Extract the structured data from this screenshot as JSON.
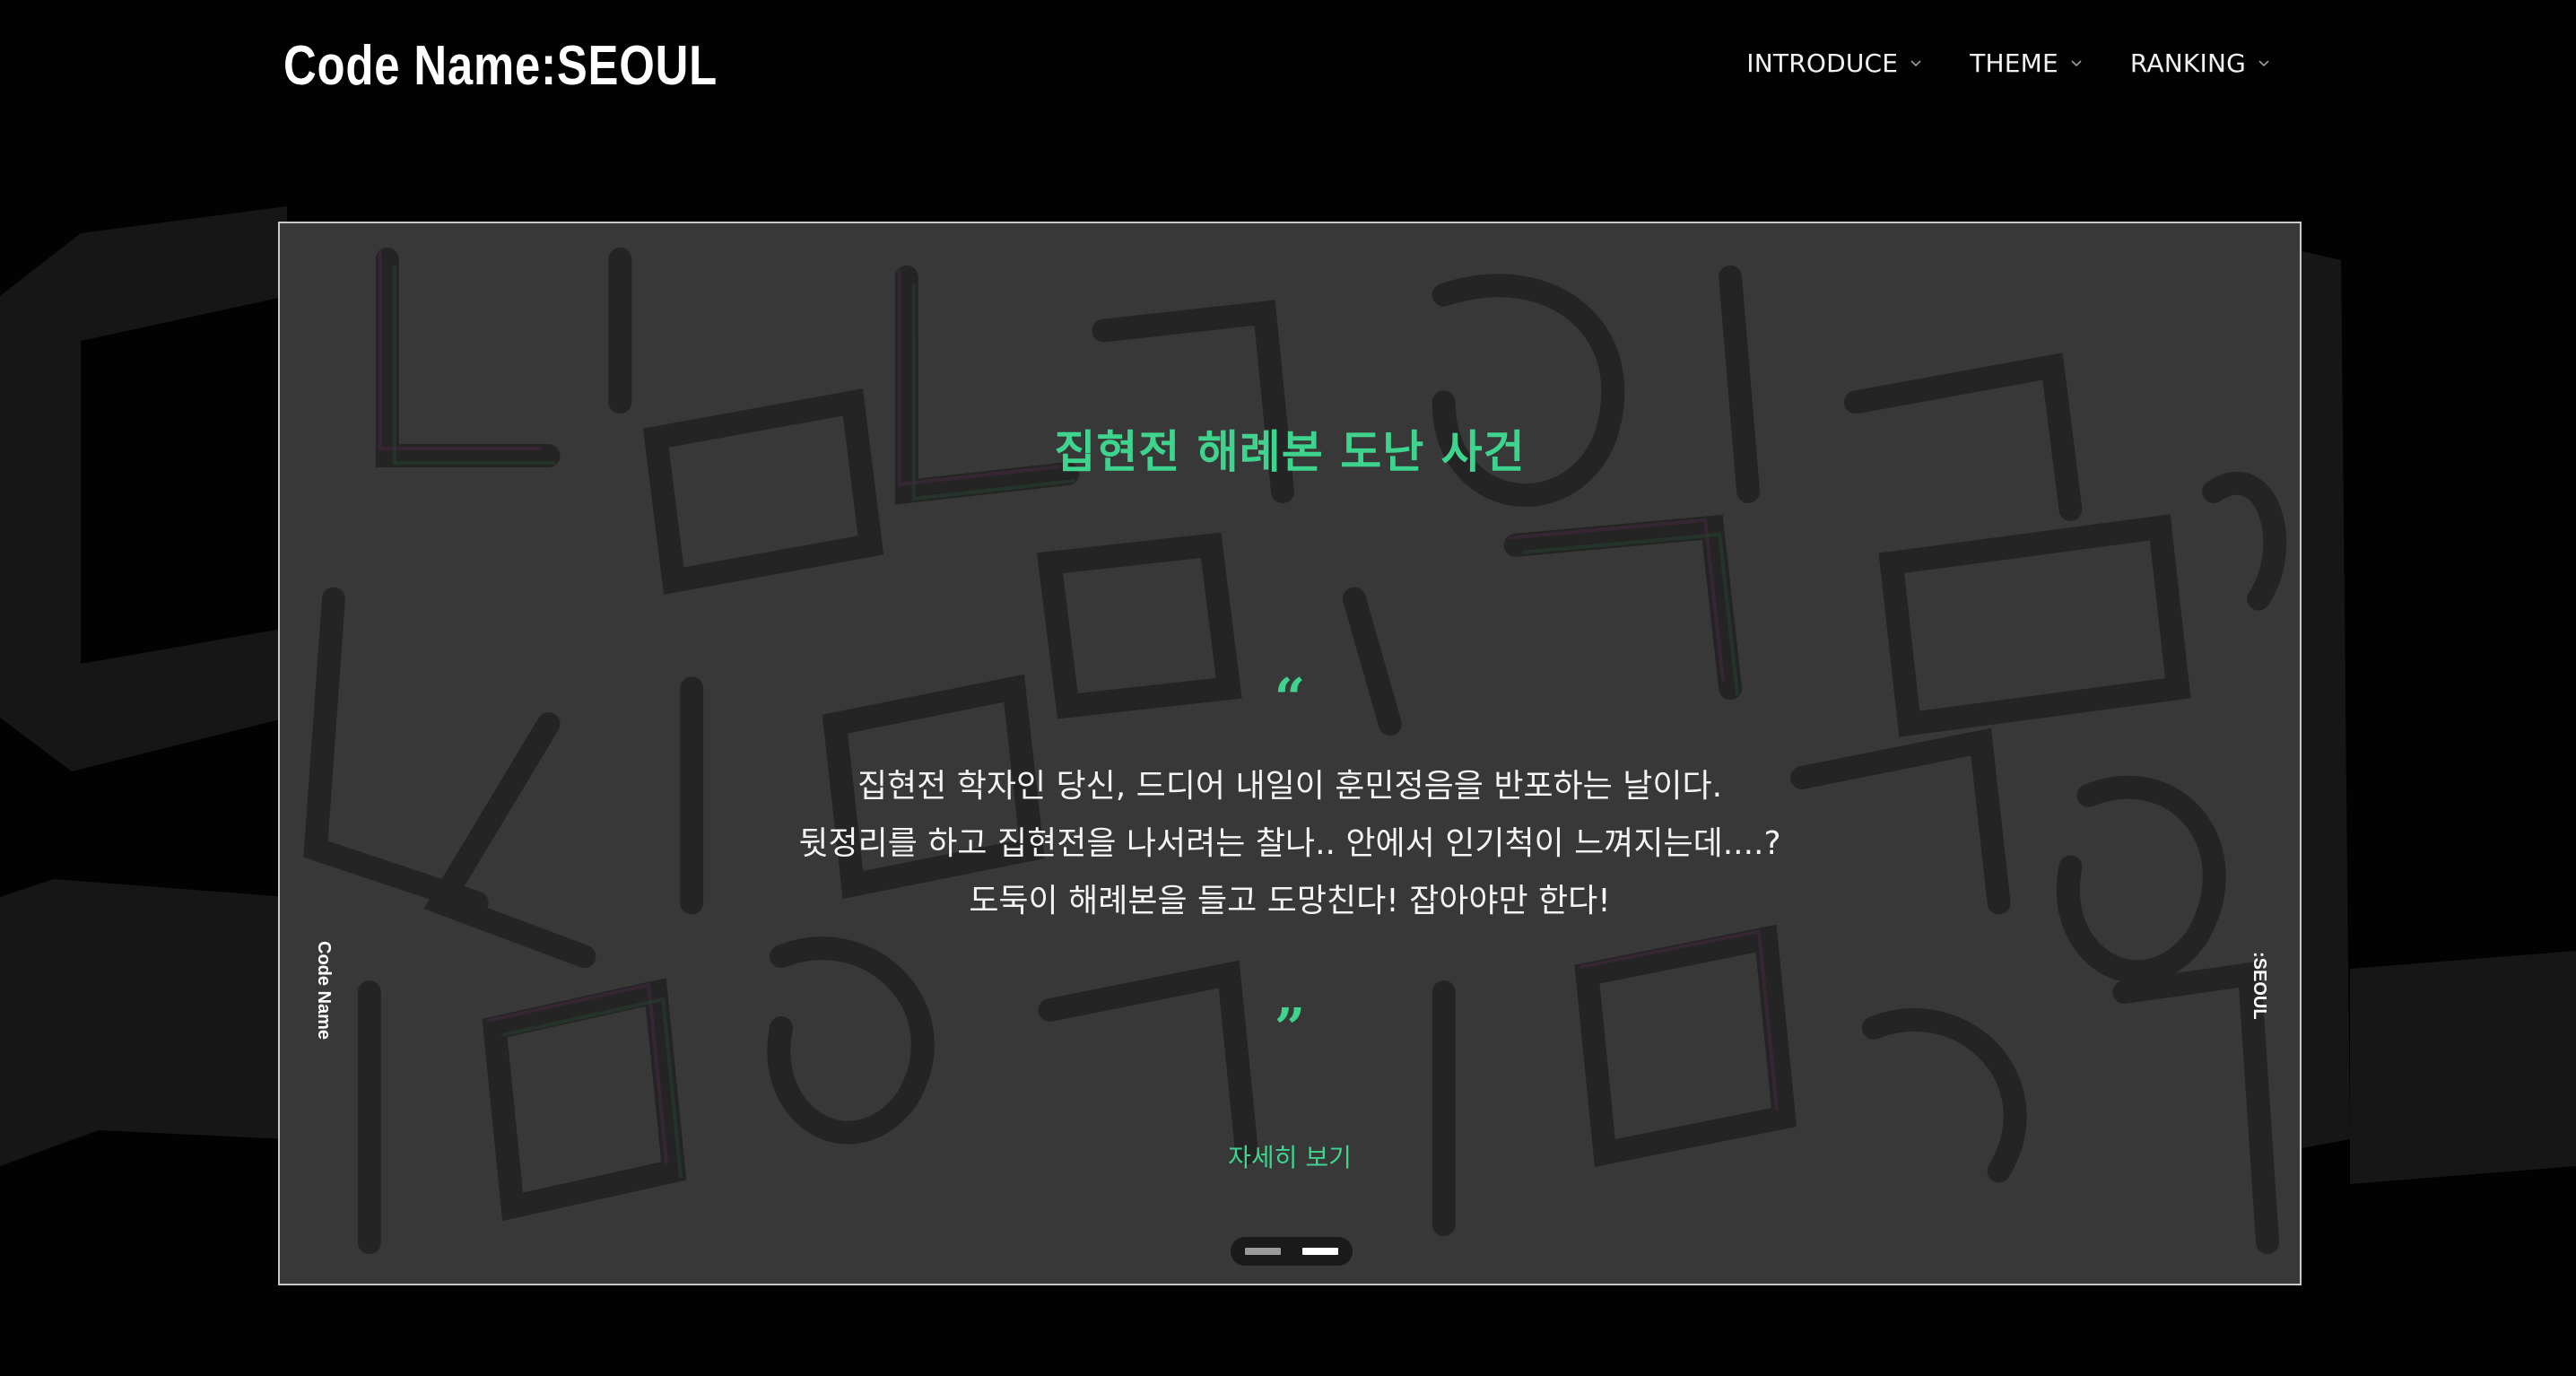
{
  "header": {
    "logo": "Code Name:SEOUL",
    "nav": [
      {
        "label": "INTRODUCE",
        "icon": "chevron-down-icon"
      },
      {
        "label": "THEME",
        "icon": "chevron-down-icon"
      },
      {
        "label": "RANKING",
        "icon": "chevron-down-icon"
      }
    ]
  },
  "hero": {
    "title": "집현전 해례본 도난 사건",
    "quote_open": "“",
    "quote_close": "”",
    "description": [
      "집현전 학자인 당신, 드디어 내일이 훈민정음을 반포하는 날이다.",
      "뒷정리를 하고 집현전을 나서려는 찰나.. 안에서 인기척이 느껴지는데....?",
      "도둑이 해례본을 들고 도망친다! 잡아야만 한다!"
    ],
    "more_label": "자세히 보기",
    "side_left": "Code Name",
    "side_right": ":SEOUL",
    "pager": {
      "count": 2,
      "active_index": 1
    }
  },
  "colors": {
    "accent": "#3fd48e",
    "background": "#020202",
    "frame_border": "#c8c8c8"
  }
}
